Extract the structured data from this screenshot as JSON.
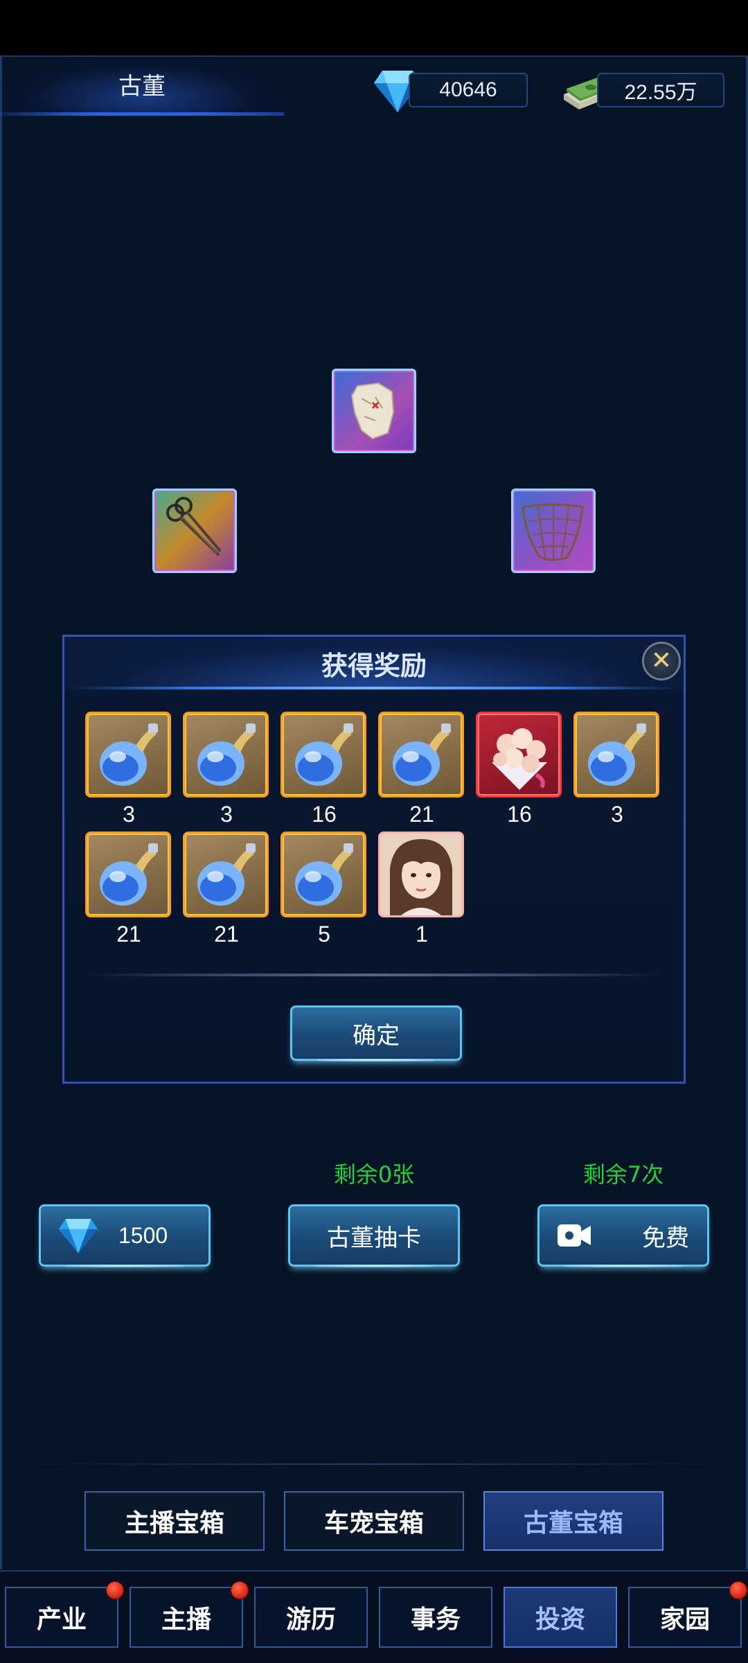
{
  "header": {
    "title": "古董",
    "diamonds": "40646",
    "cash": "22.55万"
  },
  "map_items": [
    {
      "name": "treasure-map-item"
    },
    {
      "name": "scissors-item"
    },
    {
      "name": "net-item"
    }
  ],
  "dialog": {
    "title": "获得奖励",
    "confirm_label": "确定",
    "rewards": [
      {
        "icon": "potion-flask-icon",
        "count": "3"
      },
      {
        "icon": "potion-flask-icon",
        "count": "3"
      },
      {
        "icon": "potion-flask-icon",
        "count": "16"
      },
      {
        "icon": "potion-flask-icon",
        "count": "21"
      },
      {
        "icon": "flower-bouquet-icon",
        "count": "16"
      },
      {
        "icon": "potion-flask-icon",
        "count": "3"
      },
      {
        "icon": "potion-flask-icon",
        "count": "21"
      },
      {
        "icon": "potion-flask-icon",
        "count": "21"
      },
      {
        "icon": "potion-flask-icon",
        "count": "5"
      },
      {
        "icon": "portrait-card-icon",
        "count": "1"
      }
    ]
  },
  "draw": {
    "remaining_cards": "剩余0张",
    "remaining_free": "剩余7次",
    "diamond_cost": "1500",
    "draw_label": "古董抽卡",
    "free_label": "免费"
  },
  "chest_tabs": [
    "主播宝箱",
    "车宠宝箱",
    "古董宝箱"
  ],
  "nav_tabs": [
    "产业",
    "主播",
    "游历",
    "事务",
    "投资",
    "家园"
  ],
  "colors": {
    "accent_green": "#24d13a",
    "frame_blue": "#2d55b8",
    "reward_gold_border": "#ff9a1f",
    "reward_red_border": "#ff3636",
    "badge_red": "#d81f10"
  }
}
